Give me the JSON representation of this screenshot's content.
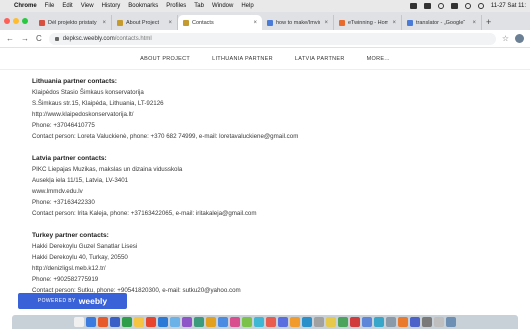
{
  "menubar": {
    "items": [
      "Chrome",
      "File",
      "Edit",
      "View",
      "History",
      "Bookmarks",
      "Profiles",
      "Tab",
      "Window",
      "Help"
    ],
    "clock": "11-27 Sat 11:"
  },
  "tabs": [
    {
      "label": "Dėl projekto pristaty",
      "fav": "#d94f3f",
      "active": false
    },
    {
      "label": "About Project",
      "fav": "#c59a2e",
      "active": false
    },
    {
      "label": "Contacts",
      "fav": "#c59a2e",
      "active": true
    },
    {
      "label": "how to make/Imvictory",
      "fav": "#4a7bd8",
      "active": false
    },
    {
      "label": "eTwinning - Homepa",
      "fav": "#e86a2d",
      "active": false
    },
    {
      "label": "translator - „Google“",
      "fav": "#4a7bd8",
      "active": false
    }
  ],
  "address": {
    "host": "depksc.weebly.com",
    "path": "/contacts.html"
  },
  "sitenav": {
    "items": [
      "ABOUT PROJECT",
      "LITHUANIA PARTNER",
      "LATVIA PARTNER",
      "MORE..."
    ]
  },
  "contacts": [
    {
      "heading": "Lithuania partner contacts:",
      "lines": [
        "Klaipėdos Stasio Šimkaus konservatorija",
        "S.Šimkaus str.15, Klaipėda, Lithuania, LT-92126",
        "http://www.klaipedoskonservatorija.lt/",
        "Phone: +37046410775",
        "Contact person: Loreta Valuckienė, phone: +370 682 74999, e-mail: loretavaluckiene@gmail.com"
      ]
    },
    {
      "heading": "Latvia partner contacts:",
      "lines": [
        "PIKC Liepajas Muzikas, makslas un dizaina vidusskola",
        "Ausekļa iela 11/15, Latvia, LV-3401",
        "www.lmmdv.edu.lv",
        "Phone: +37163422330",
        "Contact person: Irita Kaleja, phone: +37163422065, e-mail: iritakaleja@gmail.com"
      ]
    },
    {
      "heading": "Turkey partner contacts:",
      "lines": [
        "Hakki Derekoylu Guzel Sanatlar Lisesi",
        "Hakki Derekoylu 40, Turkay, 20550",
        "http://denizligsl.meb.k12.tr/",
        "Phone: +902582775919",
        "Contact person: Sutku, phone: +90541820300, e-mail: sutku20@yahoo.com"
      ]
    }
  ],
  "badge": {
    "powered": "POWERED BY",
    "brand": "weebly"
  },
  "dock": {
    "colors": [
      "#f0f0f0",
      "#3b7be0",
      "#e65a2b",
      "#3a5fc7",
      "#2f9e4a",
      "#f6c443",
      "#e8452f",
      "#2d7ad6",
      "#6ab2e8",
      "#8e55c9",
      "#3c9b7d",
      "#e2a020",
      "#4b8be2",
      "#d94e8e",
      "#7cc24a",
      "#3fb7d4",
      "#e85d4f",
      "#5a6ee0",
      "#f19b2c",
      "#2b8fc9",
      "#a1a1a1",
      "#e6c84b",
      "#4ca35c",
      "#d13b3b",
      "#5d86d8",
      "#38a6c8",
      "#8b9aa8",
      "#e97a2e",
      "#4a62c9",
      "#7a7a7a",
      "#bfbfbf",
      "#6e8fb4"
    ]
  }
}
